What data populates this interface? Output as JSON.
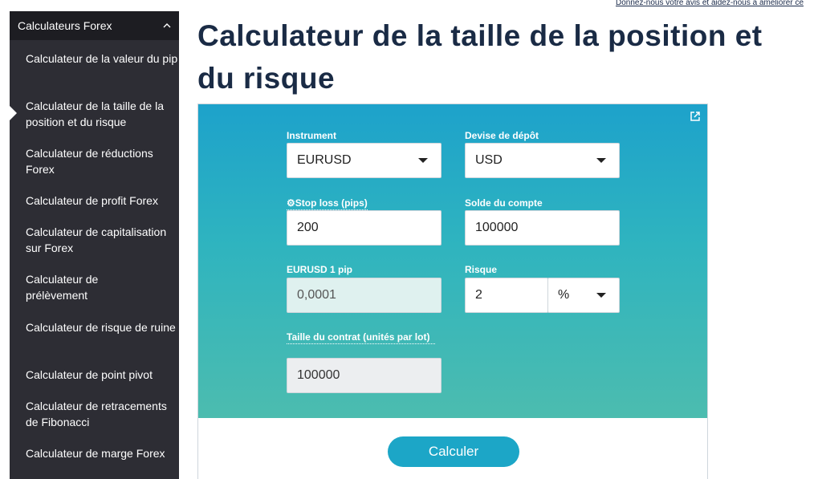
{
  "feedback_link": "Donnez-nous votre avis et aidez-nous à améliorer ce",
  "sidebar": {
    "header": "Calculateurs Forex",
    "items": [
      {
        "label": "Calculateur de la valeur du pip"
      },
      {
        "label": "Calculateur de la taille de la position et du risque",
        "active": true
      },
      {
        "label": "Calculateur de réductions Forex"
      },
      {
        "label": "Calculateur de profit Forex"
      },
      {
        "label": "Calculateur de capitalisation sur Forex"
      },
      {
        "label": "Calculateur de prélèvement"
      },
      {
        "label": "Calculateur de risque de ruine"
      },
      {
        "label": "Calculateur de point pivot"
      },
      {
        "label": "Calculateur de retracements de Fibonacci"
      },
      {
        "label": "Calculateur de marge Forex"
      }
    ]
  },
  "page_title": "Calculateur de la taille de la position et du risque",
  "calculator": {
    "instrument": {
      "label": "Instrument",
      "value": "EURUSD"
    },
    "deposit_currency": {
      "label": "Devise de dépôt",
      "value": "USD"
    },
    "stop_loss": {
      "label": "⚙Stop loss (pips)",
      "value": "200"
    },
    "account_balance": {
      "label": "Solde du compte",
      "value": "100000"
    },
    "pip_value": {
      "label": "EURUSD 1 pip",
      "value": "0,0001"
    },
    "risk": {
      "label": "Risque",
      "value": "2",
      "unit": "%"
    },
    "contract_size": {
      "label": "Taille du contrat (unités par lot)",
      "value": "100000"
    },
    "submit_label": "Calculer"
  },
  "colors": {
    "sidebar_bg": "#2d2d34",
    "title": "#1a2b45",
    "gradient_top": "#1da2cb",
    "gradient_bottom": "#4cbcaf",
    "button": "#1ca6c7"
  },
  "icons": {
    "sidebar_toggle": "chevron-up-icon",
    "popout": "external-link-icon",
    "dropdown": "caret-down-icon"
  }
}
